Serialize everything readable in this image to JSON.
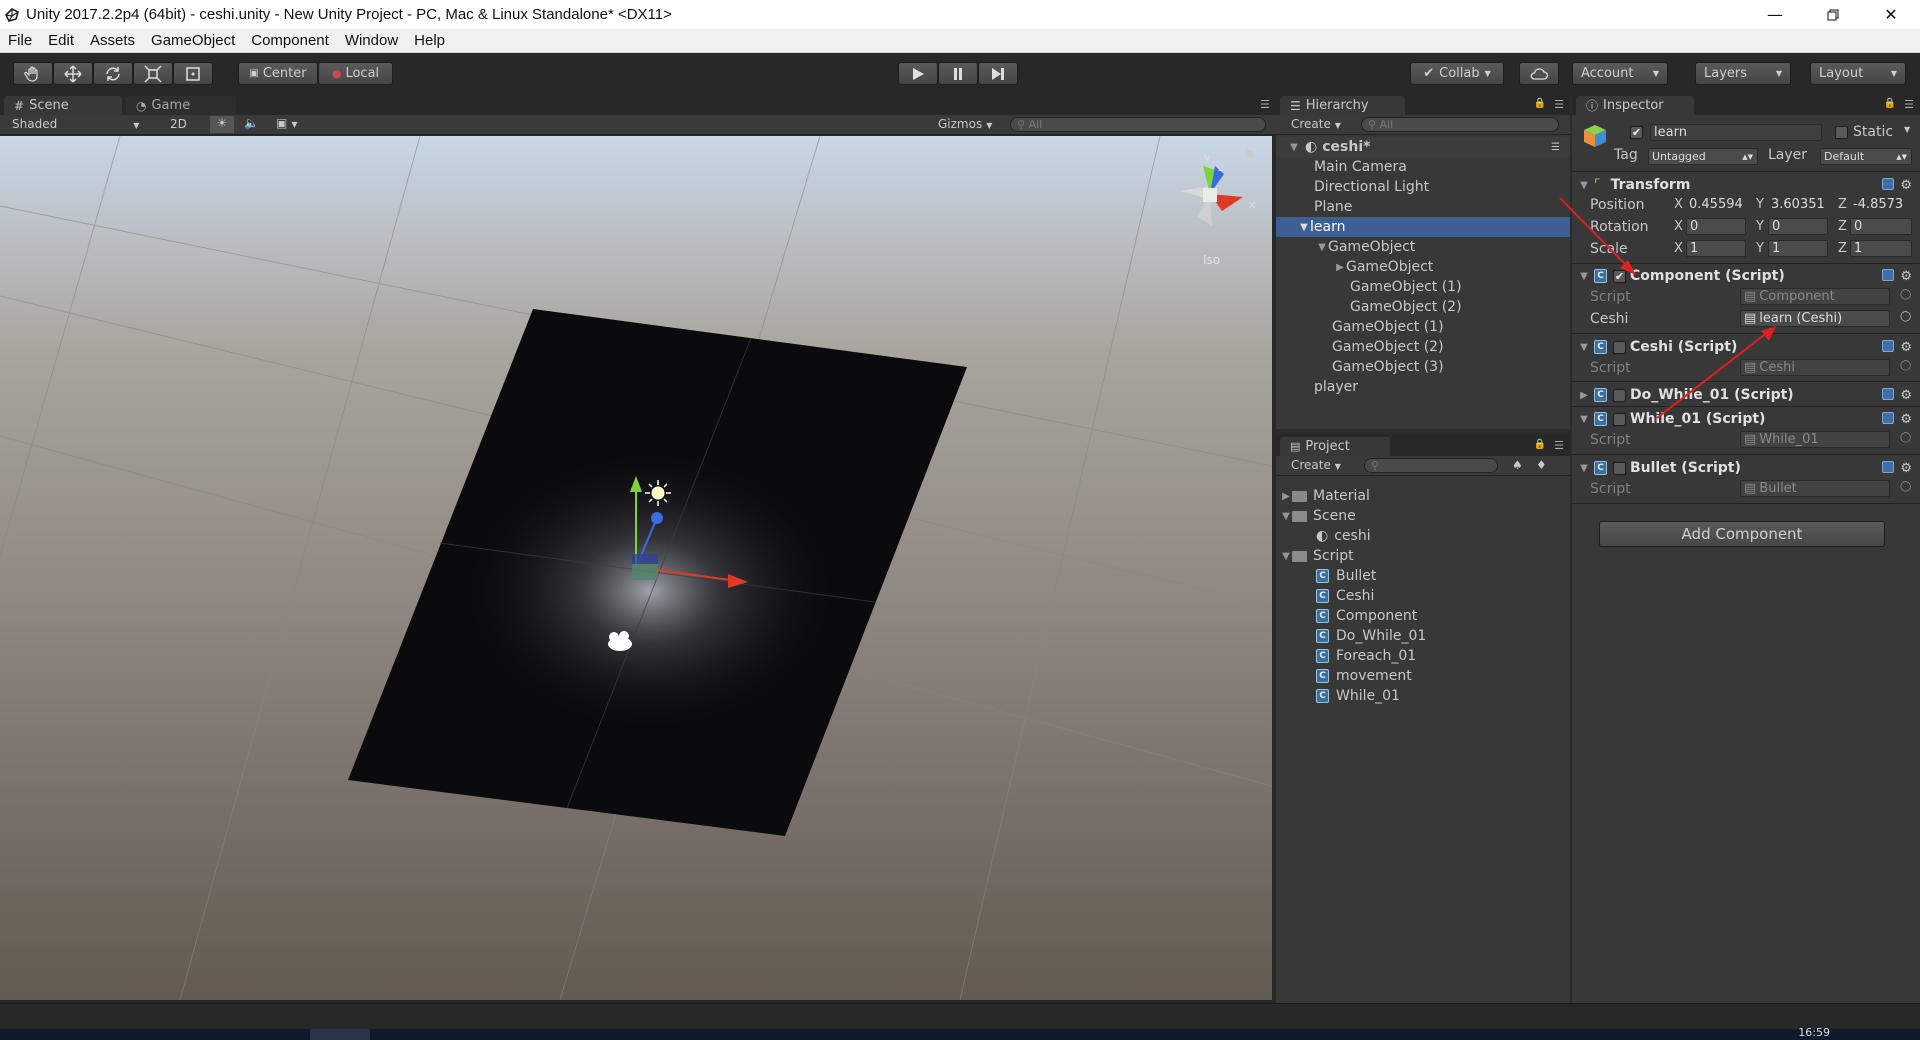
{
  "window": {
    "title": "Unity 2017.2.2p4 (64bit) - ceshi.unity - New Unity Project - PC, Mac & Linux Standalone* <DX11>"
  },
  "menu": [
    "File",
    "Edit",
    "Assets",
    "GameObject",
    "Component",
    "Window",
    "Help"
  ],
  "toolbar": {
    "pivot_label": "Center",
    "space_label": "Local",
    "collab_label": "Collab",
    "account_label": "Account",
    "layers_label": "Layers",
    "layout_label": "Layout"
  },
  "scene": {
    "tab_scene": "Scene",
    "tab_game": "Game",
    "shading": "Shaded",
    "mode_2d": "2D",
    "gizmos": "Gizmos",
    "search_placeholder": "All",
    "persp_label": "Iso",
    "axis_y": "y",
    "axis_z": "z",
    "axis_x": "x"
  },
  "hierarchy": {
    "tab": "Hierarchy",
    "create": "Create",
    "search_placeholder": "All",
    "scene_name": "ceshi*",
    "items": [
      {
        "label": "Main Camera"
      },
      {
        "label": "Directional Light"
      },
      {
        "label": "Plane"
      },
      {
        "label": "learn"
      },
      {
        "label": "GameObject"
      },
      {
        "label": "GameObject"
      },
      {
        "label": "GameObject (1)"
      },
      {
        "label": "GameObject (2)"
      },
      {
        "label": "GameObject (1)"
      },
      {
        "label": "GameObject (2)"
      },
      {
        "label": "GameObject (3)"
      },
      {
        "label": "player"
      }
    ]
  },
  "project": {
    "tab": "Project",
    "create": "Create",
    "items": [
      {
        "label": "Material"
      },
      {
        "label": "Scene"
      },
      {
        "label": "ceshi"
      },
      {
        "label": "Script"
      },
      {
        "label": "Bullet"
      },
      {
        "label": "Ceshi"
      },
      {
        "label": "Component"
      },
      {
        "label": "Do_While_01"
      },
      {
        "label": "Foreach_01"
      },
      {
        "label": "movement"
      },
      {
        "label": "While_01"
      }
    ]
  },
  "inspector": {
    "tab": "Inspector",
    "object_name": "learn",
    "static_label": "Static",
    "tag_label": "Tag",
    "tag_value": "Untagged",
    "layer_label": "Layer",
    "layer_value": "Default",
    "transform": {
      "title": "Transform",
      "position_label": "Position",
      "rotation_label": "Rotation",
      "scale_label": "Scale",
      "x": "X",
      "y": "Y",
      "z": "Z",
      "position": [
        "0.45594",
        "3.60351",
        "-4.8573"
      ],
      "rotation": [
        "0",
        "0",
        "0"
      ],
      "scale": [
        "1",
        "1",
        "1"
      ]
    },
    "components": [
      {
        "title": "Component (Script)",
        "script_label": "Script",
        "script_value": "Component",
        "extra_label": "Ceshi",
        "extra_value": "learn (Ceshi)"
      },
      {
        "title": "Ceshi (Script)",
        "script_label": "Script",
        "script_value": "Ceshi"
      },
      {
        "title": "Do_While_01 (Script)"
      },
      {
        "title": "While_01 (Script)",
        "script_label": "Script",
        "script_value": "While_01"
      },
      {
        "title": "Bullet (Script)",
        "script_label": "Script",
        "script_value": "Bullet"
      }
    ],
    "add_component": "Add Component"
  },
  "taskbar": {
    "clock": "16:59"
  },
  "colors": {
    "selection": "#3e5f96",
    "annotation_arrow": "#e02020",
    "gizmo_red": "#e03a24",
    "gizmo_green": "#7fd23a",
    "gizmo_blue": "#3b6be0"
  }
}
